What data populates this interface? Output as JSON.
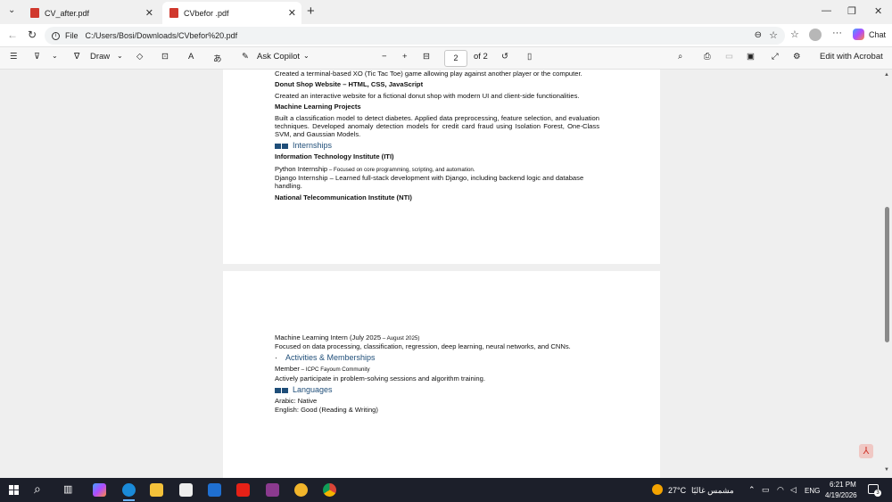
{
  "browser": {
    "tabs": [
      {
        "label": "CV_after.pdf",
        "active": false
      },
      {
        "label": "CVbefor .pdf",
        "active": true
      }
    ],
    "address": {
      "scheme_label": "File",
      "url": "C:/Users/Bosi/Downloads/CVbefor%20.pdf"
    },
    "chat_label": "Chat"
  },
  "pdf_toolbar": {
    "draw_label": "Draw",
    "ask_copilot_label": "Ask Copilot",
    "page_current": "2",
    "page_total": "of 2",
    "edit_acrobat_label": "Edit with Acrobat"
  },
  "page1": {
    "line_xo": "Created a terminal-based XO (Tic Tac Toe) game allowing play against another player or the computer.",
    "donut_title": "Donut Shop Website – HTML, CSS, JavaScript",
    "donut_desc": "Created an interactive website for a fictional donut shop with modern UI and client-side functionalities.",
    "ml_title": "Machine Learning Projects",
    "ml_desc": "Built a classification model to detect diabetes. Applied data preprocessing, feature selection, and evaluation techniques. Developed anomaly detection models for credit card fraud using Isolation Forest, One-Class SVM, and Gaussian Models.",
    "internships_heading": "Internships",
    "iti_title": "Information Technology Institute (ITI)",
    "python_main": "Python Internship",
    "python_small": " – Focused on core programming, scripting, and automation.",
    "django_line": "Django Internship – Learned full-stack development with Django, including backend logic and database handling.",
    "nti_title": "National Telecommunication Institute (NTI)"
  },
  "page2": {
    "ml_intern_main": "Machine Learning Intern (July 2025",
    "ml_intern_small": " – August 2025)",
    "ml_intern_desc": "Focused on data processing, classification, regression, deep learning, neural networks, and CNNs.",
    "bullet": "·",
    "activities_heading": "Activities & Memberships",
    "member_main": "Member",
    "member_small": " – ICPC Fayoum Community",
    "member_desc": "Actively participate in problem-solving sessions and algorithm training.",
    "languages_heading": "Languages",
    "lang_arabic": "Arabic: Native",
    "lang_english": "English: Good (Reading & Writing)"
  },
  "taskbar": {
    "weather_temp": "27°C",
    "weather_text": "مشمس غالبًا",
    "lang": "ENG",
    "time": "6:21 PM",
    "date": "4/19/2026",
    "notif_count": "3"
  },
  "colors": {
    "heading": "#1f4e79",
    "pdf_red": "#d0382d",
    "taskbar": "#1c1f2a"
  }
}
